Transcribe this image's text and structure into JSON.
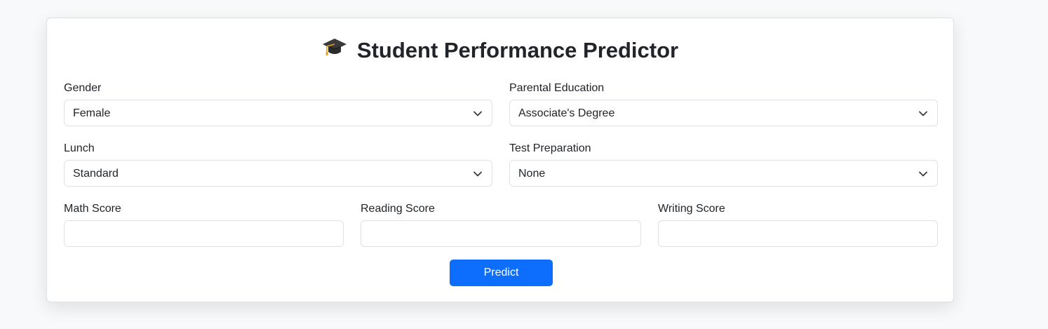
{
  "title": "Student Performance Predictor",
  "title_icon": "graduation-cap-icon",
  "form": {
    "gender": {
      "label": "Gender",
      "value": "Female"
    },
    "parental_education": {
      "label": "Parental Education",
      "value": "Associate's Degree"
    },
    "lunch": {
      "label": "Lunch",
      "value": "Standard"
    },
    "test_preparation": {
      "label": "Test Preparation",
      "value": "None"
    },
    "math_score": {
      "label": "Math Score",
      "value": ""
    },
    "reading_score": {
      "label": "Reading Score",
      "value": ""
    },
    "writing_score": {
      "label": "Writing Score",
      "value": ""
    }
  },
  "predict_label": "Predict",
  "colors": {
    "accent": "#0d6efd",
    "background": "#f8f9fa",
    "card": "#ffffff",
    "border": "#dee2e6"
  }
}
